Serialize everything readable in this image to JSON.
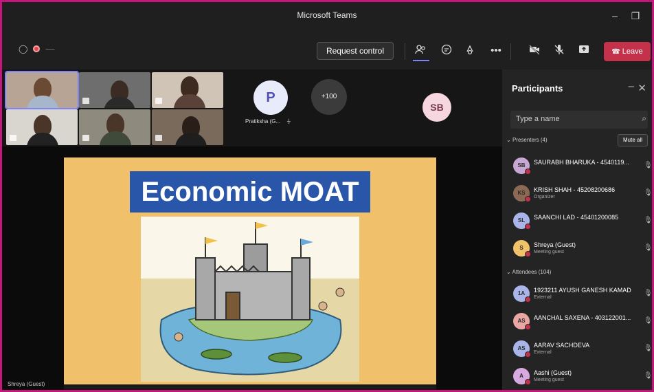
{
  "window": {
    "title": "Microsoft Teams"
  },
  "toolbar": {
    "request_control": "Request control",
    "leave": "Leave"
  },
  "strip": {
    "p_initial": "P",
    "p_name": "Pratiksha (G...",
    "more_count": "+100",
    "sb_initials": "SB"
  },
  "stage": {
    "slide_title": "Economic MOAT",
    "presenter_label": "Shreya (Guest)"
  },
  "panel": {
    "title": "Participants",
    "search_placeholder": "Type a name",
    "presenters_header": "Presenters (4)",
    "mute_all": "Mute all",
    "attendees_header": "Attendees (104)",
    "presenters": [
      {
        "initials": "SB",
        "name": "SAURABH BHARUKA - 4540119...",
        "sub": "",
        "color": "#c9a7d4"
      },
      {
        "initials": "KS",
        "name": "KRISH SHAH - 45208200686",
        "sub": "Organizer",
        "color": "#8a6a55"
      },
      {
        "initials": "SL",
        "name": "SAANCHI LAD - 45401200085",
        "sub": "",
        "color": "#a9b4e8"
      },
      {
        "initials": "S",
        "name": "Shreya (Guest)",
        "sub": "Meeting guest",
        "color": "#f2c26b"
      }
    ],
    "attendees": [
      {
        "initials": "1A",
        "name": "1923211 AYUSH GANESH KAMAD",
        "sub": "External",
        "color": "#a9b4e8"
      },
      {
        "initials": "AS",
        "name": "AANCHAL SAXENA - 403122001...",
        "sub": "",
        "color": "#e9a7a3"
      },
      {
        "initials": "AS",
        "name": "AARAV SACHDEVA",
        "sub": "External",
        "color": "#a9b4e8"
      },
      {
        "initials": "A",
        "name": "Aashi (Guest)",
        "sub": "Meeting guest",
        "color": "#d7a9e0"
      }
    ]
  },
  "colors": {
    "accent": "#7f85f5",
    "leave": "#c4314b",
    "frame": "#c2187e",
    "slide_bg": "#f1c06a",
    "slide_title_bg": "#2956a8"
  }
}
